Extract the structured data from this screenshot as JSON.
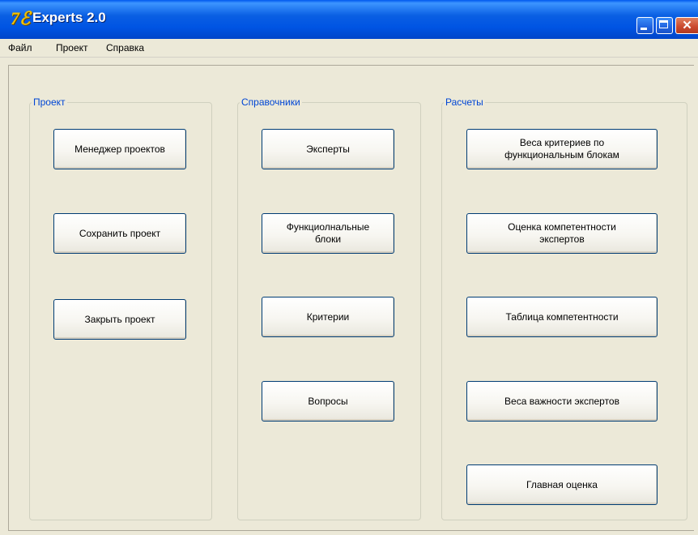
{
  "window": {
    "title": "Experts 2.0",
    "icon": "app-logo-icon",
    "icon_glyph": "7ℰ",
    "controls": {
      "minimize": "minimize-icon",
      "maximize": "maximize-icon",
      "close": "close-icon",
      "close_glyph": "✕"
    }
  },
  "menu": {
    "items": [
      "Файл",
      "Проект",
      "Справка"
    ]
  },
  "groups": {
    "project": {
      "legend": "Проект",
      "buttons": [
        "Менеджер проектов",
        "Сохранить проект",
        "Закрыть проект"
      ]
    },
    "reference": {
      "legend": "Справочники",
      "buttons": [
        "Эксперты",
        "Функциолнальные\nблоки",
        "Критерии",
        "Вопросы"
      ]
    },
    "calculations": {
      "legend": "Расчеты",
      "buttons": [
        "Веса критериев по\nфункциональным блокам",
        "Оценка компетентности\nэкспертов",
        "Таблица компетентности",
        "Веса важности экспертов",
        "Главная оценка"
      ]
    }
  },
  "colors": {
    "title_bar": "#0054e3",
    "background": "#ece9d8",
    "group_legend": "#0046d5",
    "button_border": "#003c74"
  }
}
